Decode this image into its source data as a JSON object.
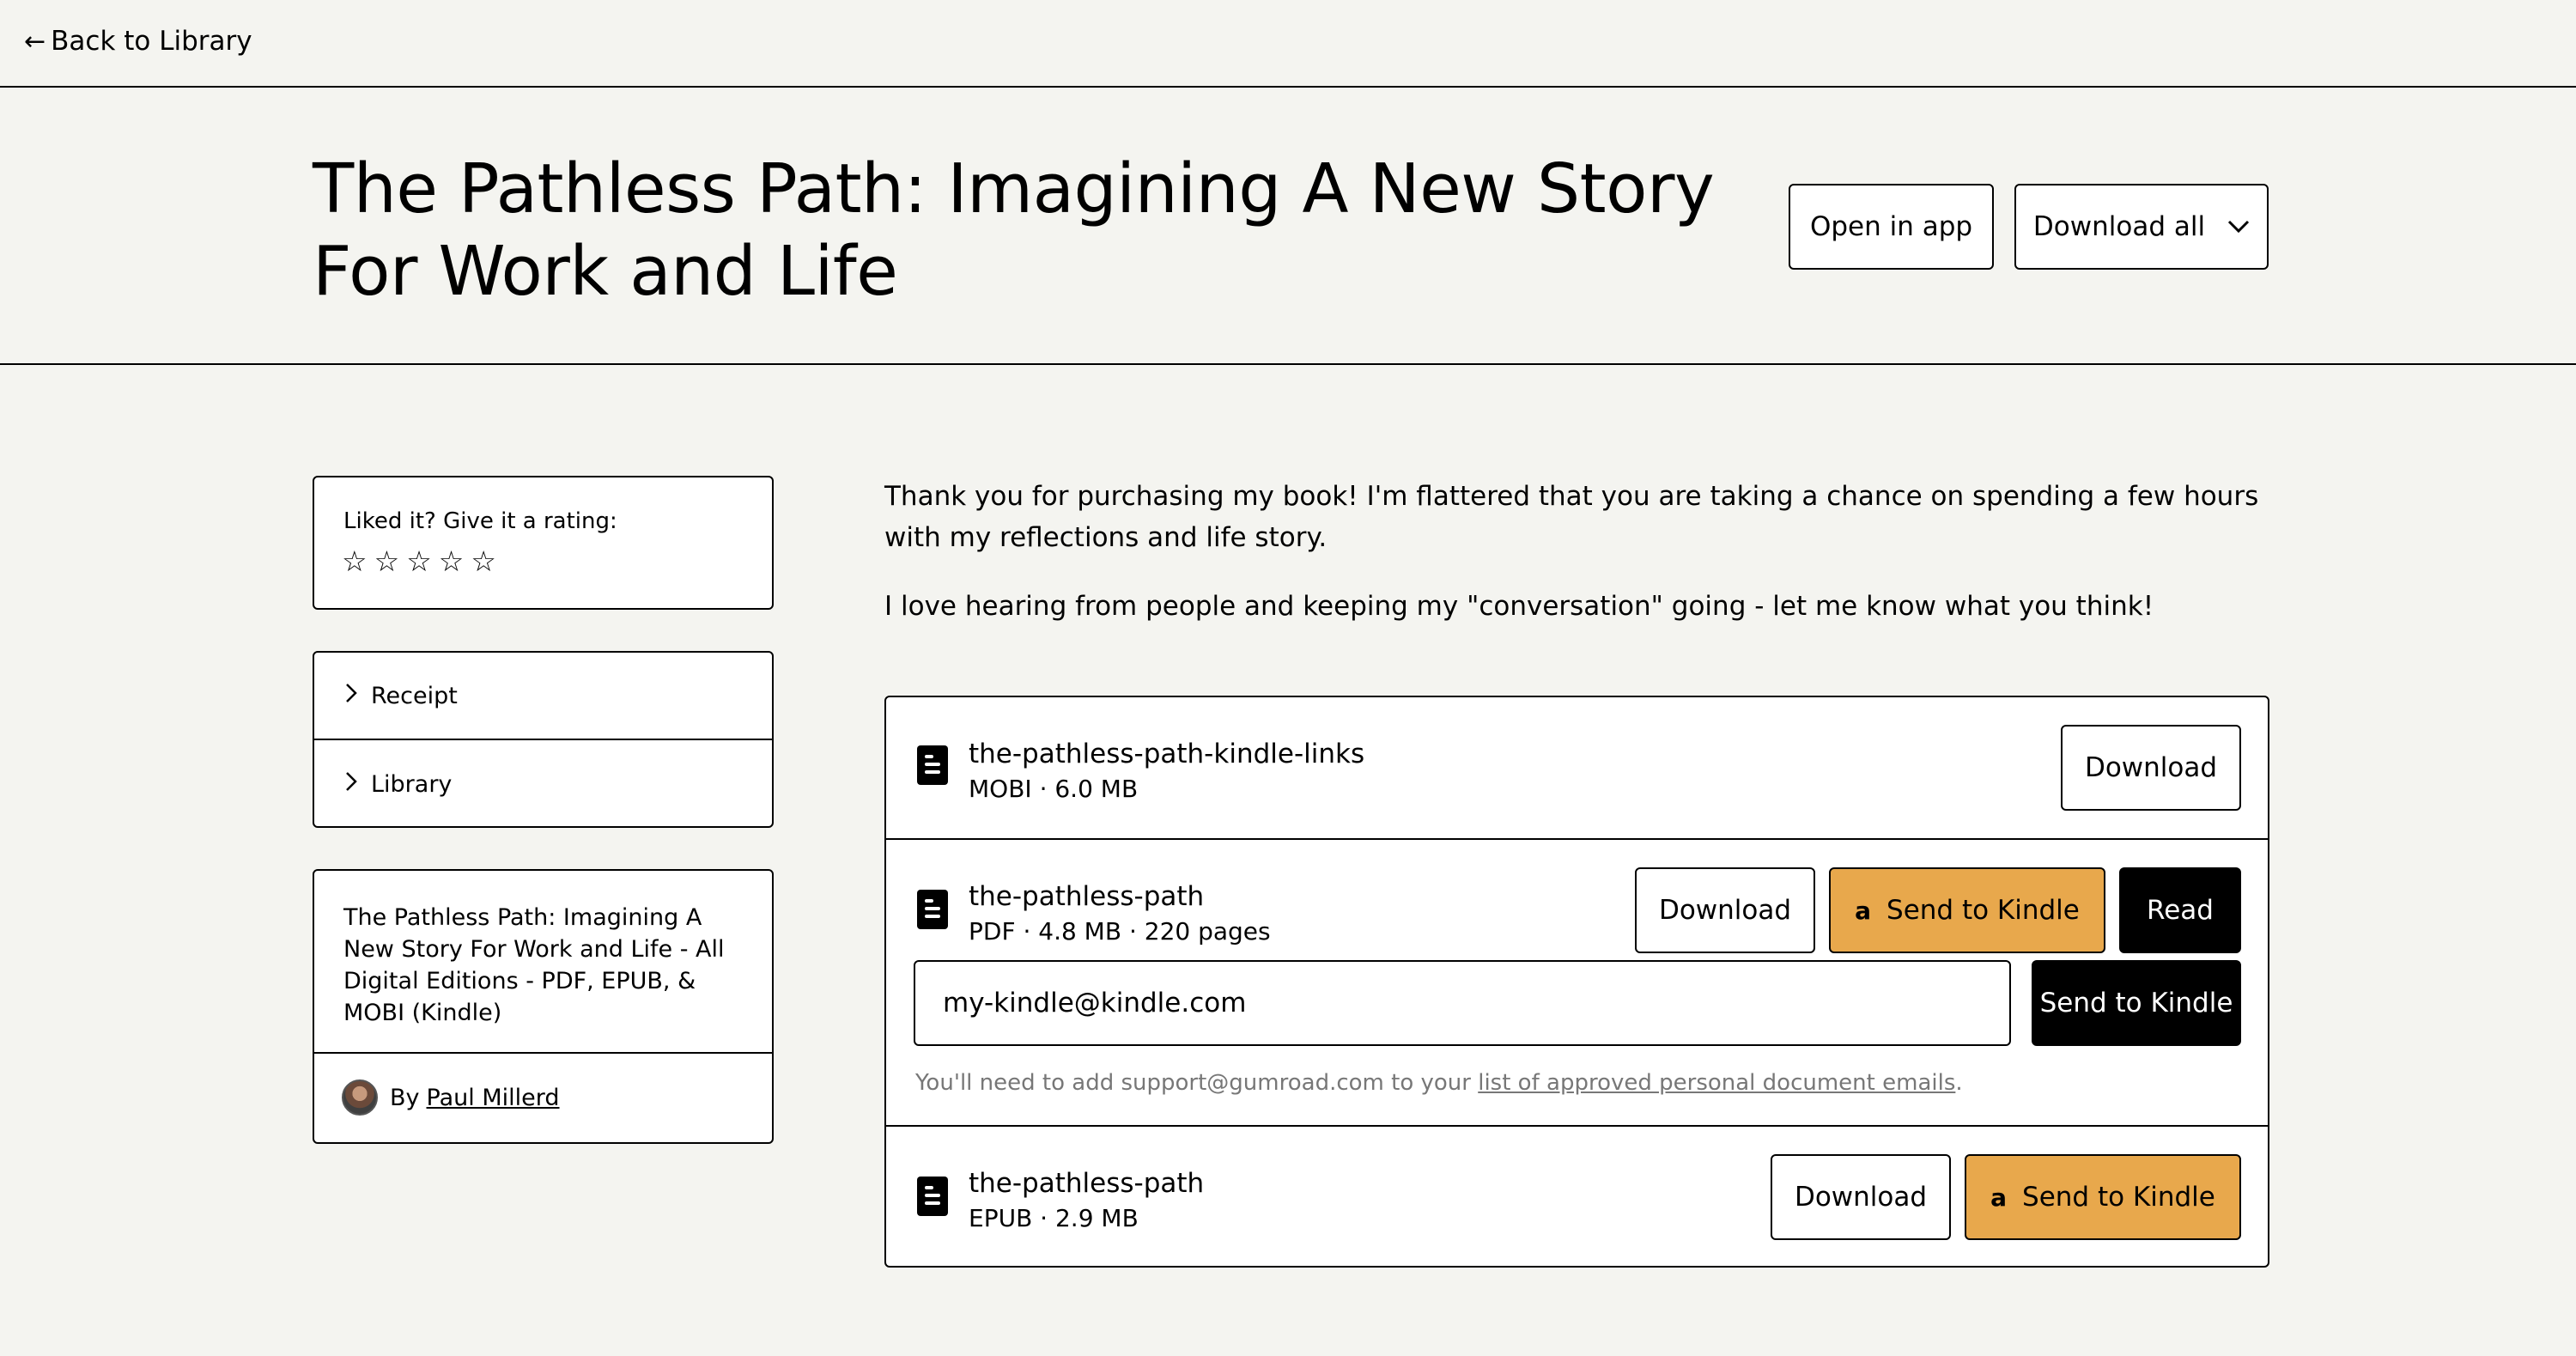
{
  "nav": {
    "back_label": "Back to Library"
  },
  "header": {
    "title": "The Pathless Path: Imagining A New Story For Work and Life",
    "open_in_app": "Open in app",
    "download_all": "Download all"
  },
  "rating": {
    "label": "Liked it? Give it a rating:",
    "stars": 5,
    "value": 0
  },
  "sidebar_links": {
    "receipt": "Receipt",
    "library": "Library"
  },
  "product": {
    "name": "The Pathless Path: Imagining A New Story For Work and Life - All Digital Editions - PDF, EPUB, & MOBI (Kindle)",
    "by_label": "By",
    "creator": "Paul Millerd"
  },
  "message": {
    "p1": "Thank you for purchasing my book! I'm flattered that you are taking a chance on spending a few hours with my reflections and life story.",
    "p2": "I love hearing from people and keeping my \"conversation\" going - let me know what you think!"
  },
  "files": [
    {
      "name": "the-pathless-path-kindle-links",
      "meta": "MOBI · 6.0 MB",
      "download": "Download"
    },
    {
      "name": "the-pathless-path",
      "meta": "PDF · 4.8 MB · 220 pages",
      "download": "Download",
      "send_to_kindle": "Send to Kindle",
      "read": "Read"
    },
    {
      "name": "the-pathless-path",
      "meta": "EPUB · 2.9 MB",
      "download": "Download",
      "send_to_kindle": "Send to Kindle"
    }
  ],
  "kindle": {
    "email_value": "my-kindle@kindle.com",
    "send_label": "Send to Kindle",
    "note_prefix": "You'll need to add support@gumroad.com to your ",
    "note_link": "list of approved personal document emails",
    "note_suffix": "."
  },
  "icons": {
    "back": "arrow-left-icon",
    "chevron_down": "chevron-down-icon",
    "chevron_right": "chevron-right-icon",
    "star": "star-outline-icon",
    "file": "file-document-icon",
    "amazon": "amazon-icon"
  },
  "colors": {
    "background": "#f4f4f0",
    "accent_orange": "#e8a84c",
    "black": "#000000",
    "muted_text": "#777777"
  }
}
